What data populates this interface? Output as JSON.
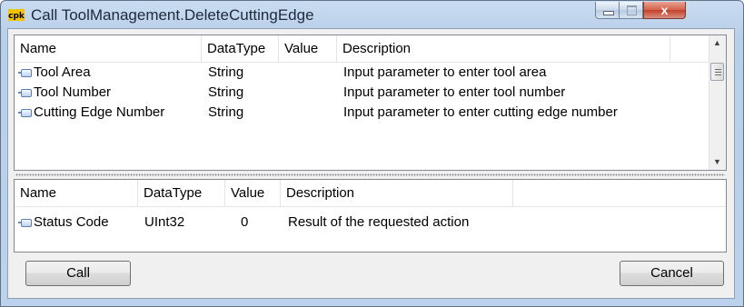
{
  "window": {
    "title": "Call ToolManagement.DeleteCuttingEdge",
    "icon": "cpk-logo-icon",
    "controls": {
      "minimize": "minimize-icon",
      "maximize": "maximize-icon",
      "close_label": "x"
    }
  },
  "input_grid": {
    "columns": [
      "Name",
      "DataType",
      "Value",
      "Description"
    ],
    "rows": [
      {
        "name": "Tool Area",
        "datatype": "String",
        "value": "",
        "description": "Input parameter to enter tool area"
      },
      {
        "name": "Tool Number",
        "datatype": "String",
        "value": "",
        "description": "Input parameter to enter tool number"
      },
      {
        "name": "Cutting Edge Number",
        "datatype": "String",
        "value": "",
        "description": "Input parameter to enter cutting edge number"
      }
    ]
  },
  "output_grid": {
    "columns": [
      "Name",
      "DataType",
      "Value",
      "Description"
    ],
    "rows": [
      {
        "name": "Status Code",
        "datatype": "UInt32",
        "value": "0",
        "description": "Result of the requested action"
      }
    ]
  },
  "buttons": {
    "call": "Call",
    "cancel": "Cancel"
  },
  "colors": {
    "title_bar": "#c9dcf1",
    "close_button": "#c2402a",
    "grid_border": "#828790"
  }
}
